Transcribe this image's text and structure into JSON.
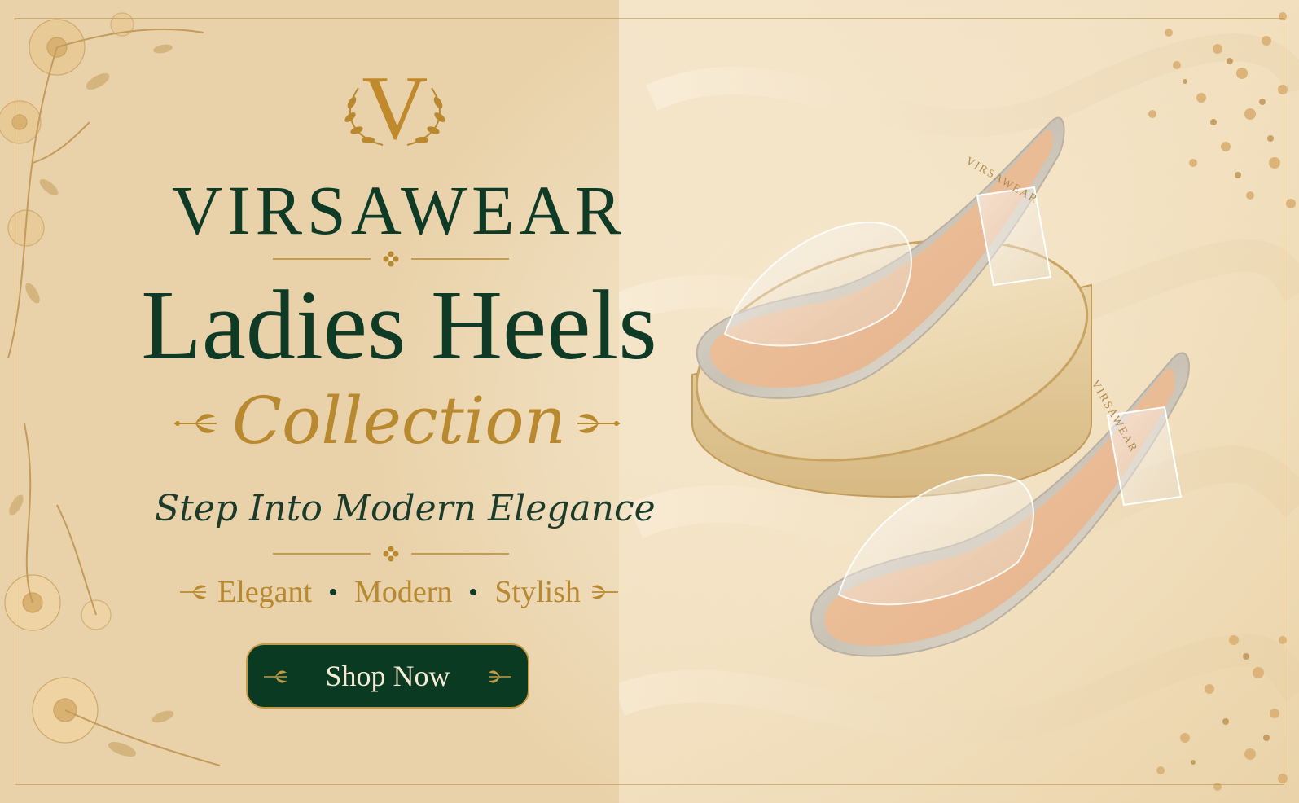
{
  "brand": {
    "monogram": "V",
    "name": "VIRSAWEAR"
  },
  "headline": {
    "title": "Ladies Heels",
    "subtitle": "Collection",
    "tagline": "Step Into Modern Elegance"
  },
  "features": [
    "Elegant",
    "Modern",
    "Stylish"
  ],
  "cta": {
    "label": "Shop Now"
  },
  "product": {
    "insole_print": "VIRSAWEAR"
  },
  "colors": {
    "dark_green": "#0e3a26",
    "gold": "#b8892f",
    "cream": "#f3e3c6",
    "button_bg": "#0b3a23"
  },
  "icons": {
    "monogram_wreath": "laurel-wreath-icon",
    "divider_ornament": "floral-ornament-icon",
    "flourish": "leaf-flourish-icon",
    "separator": "dot-icon"
  }
}
